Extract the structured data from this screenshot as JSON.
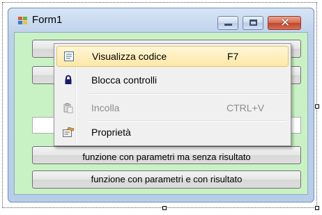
{
  "window": {
    "title": "Form1",
    "close_glyph": "✕",
    "icon": "windows-form-icon"
  },
  "form": {
    "background": "#c9f2c4",
    "buttons": [
      {
        "label": "funzione con parametri ma senza risultato"
      },
      {
        "label": "funzione con parametri e con risultato"
      }
    ]
  },
  "context_menu": {
    "items": [
      {
        "label": "Visualizza codice",
        "shortcut": "F7",
        "icon": "view-code-icon",
        "selected": true,
        "enabled": true
      },
      {
        "label": "Blocca controlli",
        "shortcut": "",
        "icon": "lock-icon",
        "selected": false,
        "enabled": true
      },
      {
        "label": "Incolla",
        "shortcut": "CTRL+V",
        "icon": "paste-icon",
        "selected": false,
        "enabled": false
      },
      {
        "label": "Proprietà",
        "shortcut": "",
        "icon": "properties-icon",
        "selected": false,
        "enabled": true
      }
    ],
    "highlight_color": "#fde8a7"
  }
}
